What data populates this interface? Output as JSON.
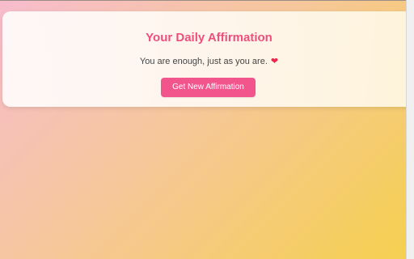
{
  "card": {
    "title": "Your Daily Affirmation",
    "message": "You are enough, just as you are.",
    "heart_icon": "heart-icon",
    "button_label": "Get New Affirmation"
  },
  "colors": {
    "title": "#ef4f7d",
    "button": "#f2558c",
    "background_start": "#f7bccd",
    "background_end": "#f5d04e"
  }
}
